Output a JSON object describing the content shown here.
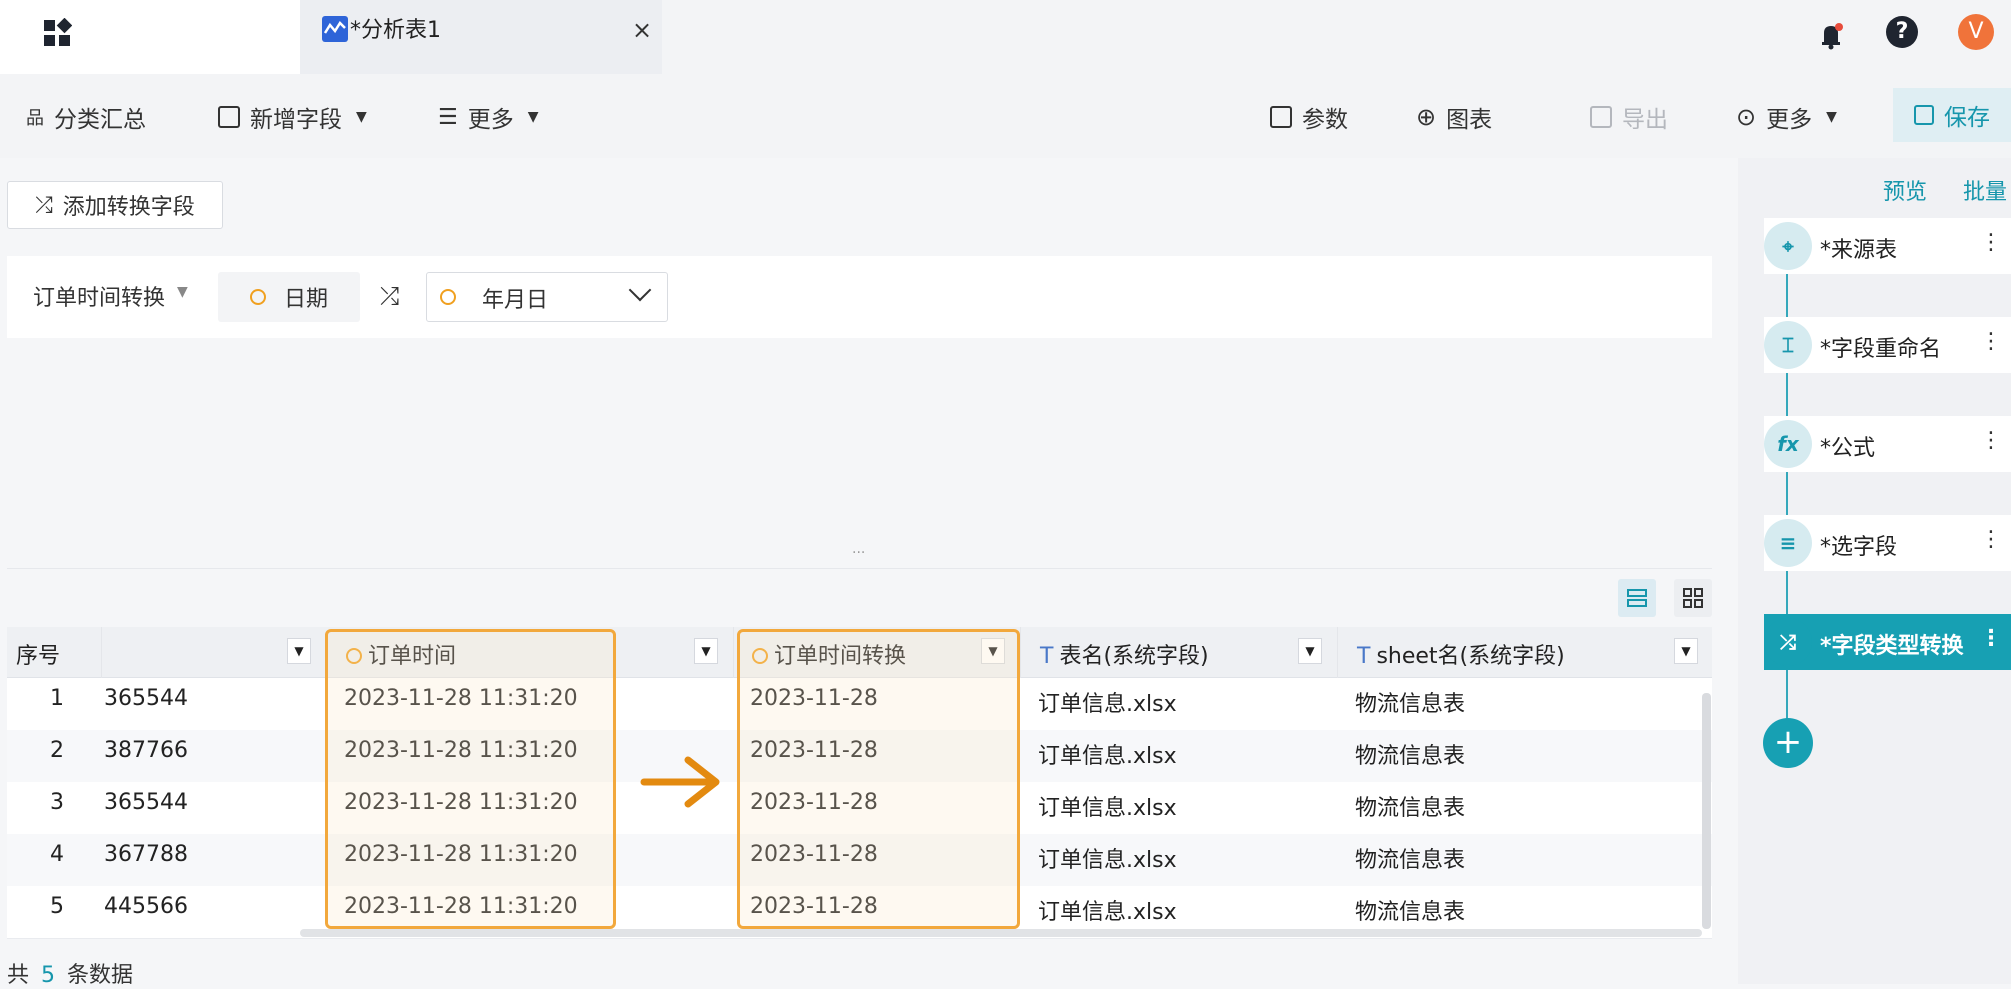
{
  "window": {
    "tab_title": "*分析表1",
    "tab_close": "×"
  },
  "header_icons": {
    "avatar_letter": "V",
    "help": "?"
  },
  "toolbar": {
    "group": "分类汇总",
    "add_field": "新增字段",
    "more_left": "更多",
    "params": "参数",
    "chart": "图表",
    "export": "导出",
    "more_right": "更多",
    "save": "保存"
  },
  "transform": {
    "add_button": "添加转换字段",
    "field_name": "订单时间转换",
    "from_type": "日期",
    "to_format": "年月日"
  },
  "table": {
    "columns": [
      "序号",
      "订单时间",
      "订单时间转换",
      "表名(系统字段)",
      "sheet名(系统字段)"
    ],
    "rows": [
      {
        "idx": "1",
        "partial": "365544",
        "time": "2023-11-28 11:31:20",
        "converted": "2023-11-28",
        "table": "订单信息.xlsx",
        "sheet": "物流信息表"
      },
      {
        "idx": "2",
        "partial": "387766",
        "time": "2023-11-28 11:31:20",
        "converted": "2023-11-28",
        "table": "订单信息.xlsx",
        "sheet": "物流信息表"
      },
      {
        "idx": "3",
        "partial": "365544",
        "time": "2023-11-28 11:31:20",
        "converted": "2023-11-28",
        "table": "订单信息.xlsx",
        "sheet": "物流信息表"
      },
      {
        "idx": "4",
        "partial": "367788",
        "time": "2023-11-28 11:31:20",
        "converted": "2023-11-28",
        "table": "订单信息.xlsx",
        "sheet": "物流信息表"
      },
      {
        "idx": "5",
        "partial": "445566",
        "time": "2023-11-28 11:31:20",
        "converted": "2023-11-28",
        "table": "订单信息.xlsx",
        "sheet": "物流信息表"
      }
    ]
  },
  "footer": {
    "prefix": "共",
    "count": "5",
    "suffix": "条数据"
  },
  "flow": {
    "preview": "预览",
    "batch": "批量",
    "steps": [
      {
        "label": "*来源表",
        "icon": "target-icon"
      },
      {
        "label": "*字段重命名",
        "icon": "rename-icon"
      },
      {
        "label": "*公式",
        "icon": "fx-icon"
      },
      {
        "label": "*选字段",
        "icon": "select-field-icon"
      },
      {
        "label": "*字段类型转换",
        "icon": "shuffle-icon",
        "active": true
      }
    ]
  },
  "colors": {
    "accent": "#17a0b3",
    "highlight": "#f2a83c"
  }
}
